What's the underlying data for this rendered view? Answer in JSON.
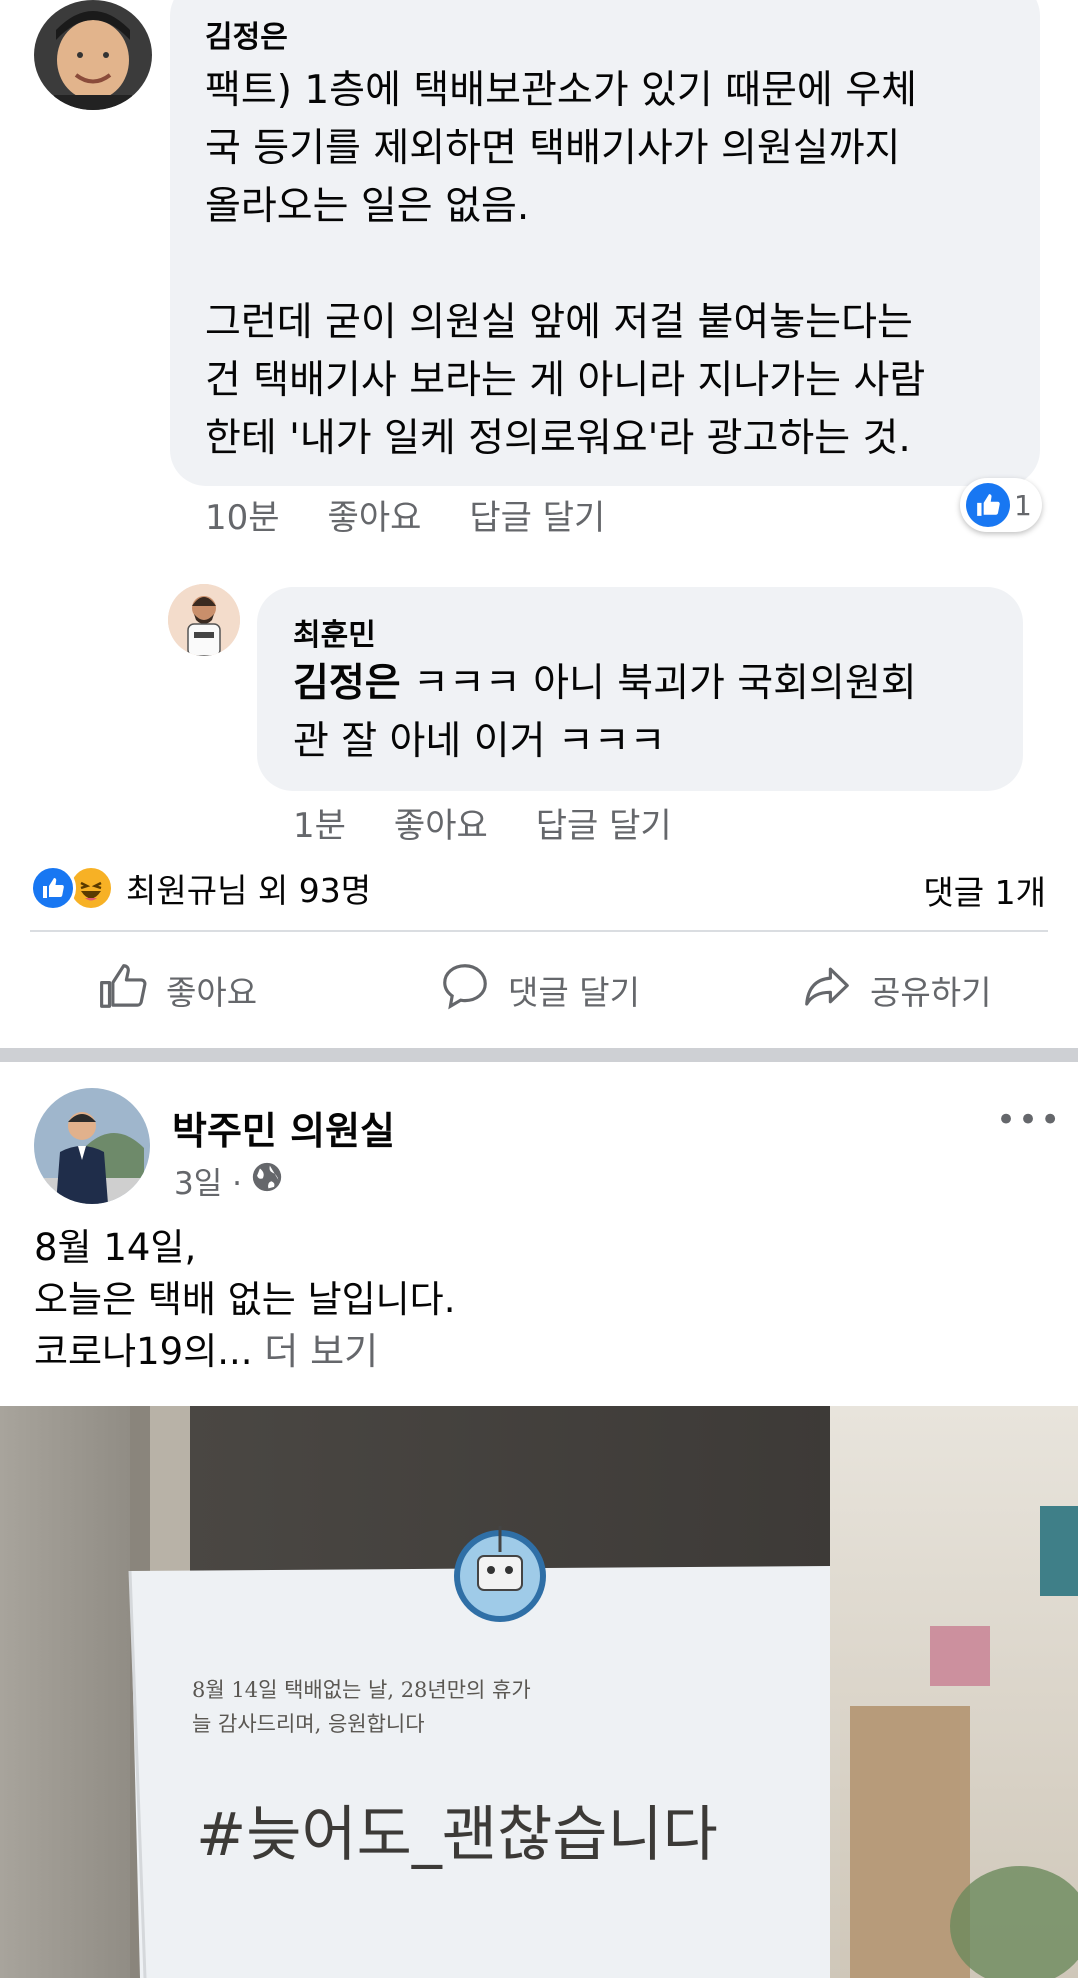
{
  "comment": {
    "author": "김정은",
    "text": "팩트) 1층에 택배보관소가 있기 때문에 우체\n국 등기를 제외하면 택배기사가 의원실까지\n올라오는 일은 없음.\n\n그런데 굳이 의원실 앞에 저걸 붙여놓는다는\n건 택배기사 보라는 게 아니라 지나가는 사람\n한테 '내가 일케 정의로워요'라 광고하는 것.",
    "time": "10분",
    "like_label": "좋아요",
    "reply_label": "답글 달기",
    "reaction_count": "1"
  },
  "reply": {
    "author": "최훈민",
    "mention": "김정은",
    "text_line1": " ㅋㅋㅋ 아니 북괴가 국회의원회",
    "text_line2": "관 잘 아네 이거 ㅋㅋㅋ",
    "time": "1분",
    "like_label": "좋아요",
    "reply_label": "답글 달기"
  },
  "summary": {
    "reactions_text": "최원규님 외 93명",
    "comments_text": "댓글 1개"
  },
  "actions": {
    "like": "좋아요",
    "comment": "댓글 달기",
    "share": "공유하기"
  },
  "post": {
    "page_name": "박주민 의원실",
    "time": "3일 ·",
    "text_line1": "8월 14일,",
    "text_line2": "오늘은 택배 없는 날입니다.",
    "text_line3": "코로나19의...",
    "see_more": " 더 보기",
    "more_icon": "•••"
  },
  "photo": {
    "notice_line1": "8월 14일 택배없는 날, 28년만의 휴가",
    "notice_line2": "늘 감사드리며, 응원합니다",
    "notice_hashtag": "#늦어도_괜찮습니다"
  },
  "colors": {
    "accent": "#1877f2",
    "secondary_text": "#65676b",
    "bubble": "#f0f2f5"
  }
}
